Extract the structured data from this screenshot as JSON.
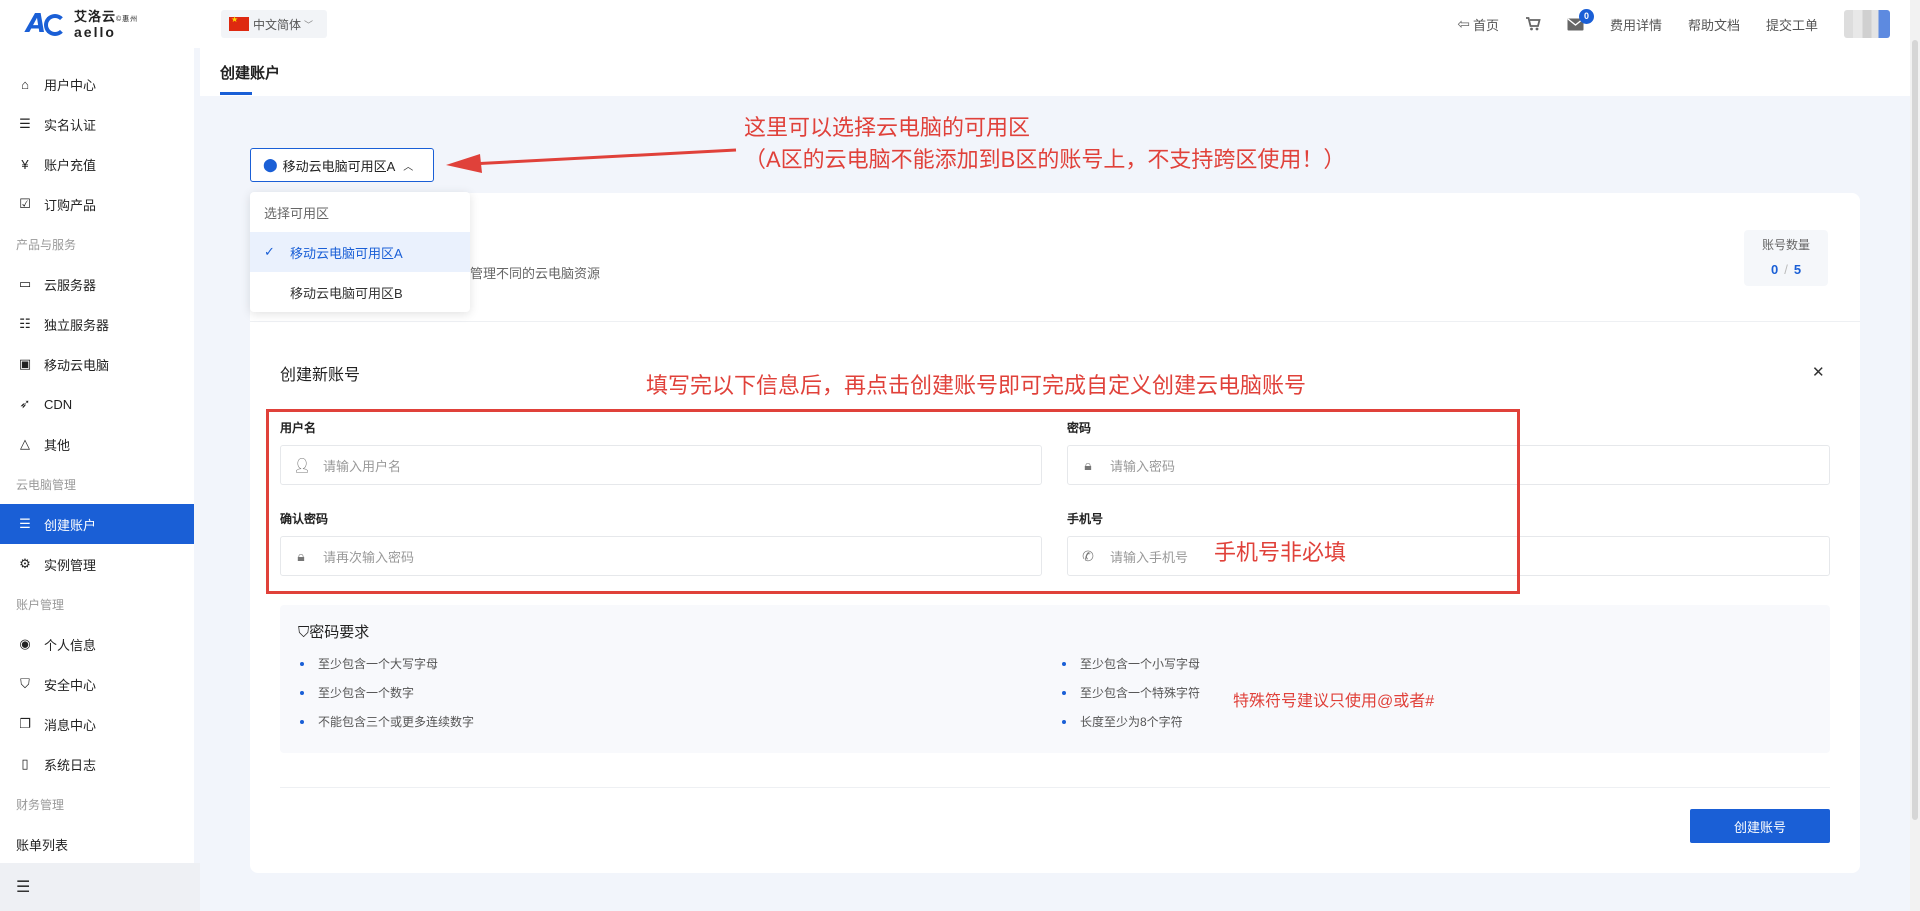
{
  "header": {
    "brand_cn": "艾洛云",
    "brand_sub": "©惠州",
    "brand_en": "aello",
    "language": "中文简体",
    "nav": {
      "home": "首页",
      "message_count": "0",
      "billing": "费用详情",
      "help": "帮助文档",
      "ticket": "提交工单"
    }
  },
  "sidebar": {
    "items": [
      {
        "label": "用户中心",
        "icon": "home-icon"
      },
      {
        "label": "实名认证",
        "icon": "id-card-icon"
      },
      {
        "label": "账户充值",
        "icon": "yen-icon"
      },
      {
        "label": "订购产品",
        "icon": "checkbox-icon"
      }
    ],
    "group_products": "产品与服务",
    "products": [
      {
        "label": "云服务器",
        "icon": "server-icon"
      },
      {
        "label": "独立服务器",
        "icon": "dedicated-server-icon"
      },
      {
        "label": "移动云电脑",
        "icon": "monitor-icon"
      },
      {
        "label": "CDN",
        "icon": "rocket-icon"
      },
      {
        "label": "其他",
        "icon": "triangle-icon"
      }
    ],
    "group_cloud_pc": "云电脑管理",
    "cloud_pc": [
      {
        "label": "创建账户",
        "icon": "user-card-icon",
        "active": true
      },
      {
        "label": "实例管理",
        "icon": "gear-icon"
      }
    ],
    "group_account": "账户管理",
    "account": [
      {
        "label": "个人信息",
        "icon": "user-circle-icon"
      },
      {
        "label": "安全中心",
        "icon": "shield-icon"
      },
      {
        "label": "消息中心",
        "icon": "message-icon"
      },
      {
        "label": "系统日志",
        "icon": "document-icon"
      }
    ],
    "group_finance": "财务管理",
    "finance": [
      {
        "label": "账单列表"
      }
    ]
  },
  "page": {
    "title": "创建账户"
  },
  "zone": {
    "selected": "移动云电脑可用区A",
    "dropdown_title": "选择可用区",
    "options": [
      {
        "label": "移动云电脑可用区A",
        "selected": true
      },
      {
        "label": "移动云电脑可用区B",
        "selected": false
      }
    ]
  },
  "card": {
    "description_partial": "管理不同的云电脑资源",
    "account_count_label": "账号数量",
    "account_count_used": "0",
    "account_count_total": "5"
  },
  "form": {
    "title": "创建新账号",
    "username_label": "用户名",
    "username_placeholder": "请输入用户名",
    "password_label": "密码",
    "password_placeholder": "请输入密码",
    "confirm_label": "确认密码",
    "confirm_placeholder": "请再次输入密码",
    "phone_label": "手机号",
    "phone_placeholder": "请输入手机号"
  },
  "password_rules": {
    "title": "密码要求",
    "rules": [
      "至少包含一个大写字母",
      "至少包含一个小写字母",
      "至少包含一个数字",
      "至少包含一个特殊字符",
      "不能包含三个或更多连续数字",
      "长度至少为8个字符"
    ]
  },
  "create_button": "创建账号",
  "annotations": {
    "zone_line1": "这里可以选择云电脑的可用区",
    "zone_line2": "（A区的云电脑不能添加到B区的账号上，不支持跨区使用！）",
    "form_hint": "填写完以下信息后，再点击创建账号即可完成自定义创建云电脑账号",
    "phone_optional": "手机号非必填",
    "special_char_tip": "特殊符号建议只使用@或者#"
  },
  "colors": {
    "accent": "#1a5fd6",
    "annotation": "#e0413a",
    "background": "#f2f5fb"
  }
}
